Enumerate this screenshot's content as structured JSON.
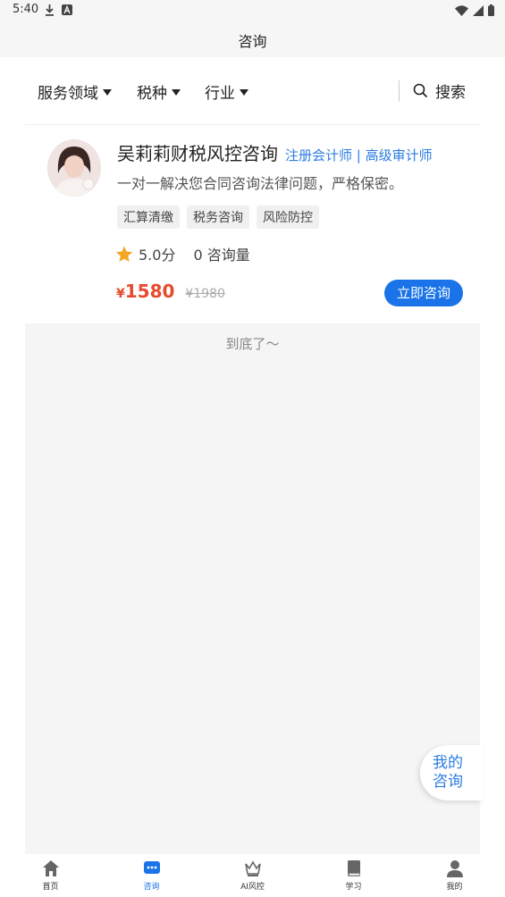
{
  "status_bar": {
    "time": "5:40"
  },
  "title_bar": {
    "title": "咨询"
  },
  "filters": {
    "items": [
      {
        "label": "服务领域"
      },
      {
        "label": "税种"
      },
      {
        "label": "行业"
      }
    ],
    "search_label": "搜索"
  },
  "advisor": {
    "name": "吴莉莉财税风控咨询",
    "title": "注册会计师 | 高级审计师",
    "description": "一对一解决您合同咨询法律问题，严格保密。",
    "tags": [
      "汇算清缴",
      "税务咨询",
      "风险防控"
    ],
    "rating": "5.0分",
    "consult_count": "0 咨询量",
    "currency": "¥",
    "price": "1580",
    "original_price": "¥1980",
    "consult_button": "立即咨询"
  },
  "list_end_text": "到底了～",
  "float_button": {
    "line1": "我的",
    "line2": "咨询"
  },
  "tab_bar": {
    "tabs": [
      {
        "label": "首页",
        "icon": "home-icon"
      },
      {
        "label": "咨询",
        "icon": "chat-icon",
        "active": true
      },
      {
        "label": "AI风控",
        "icon": "crown-icon"
      },
      {
        "label": "学习",
        "icon": "book-icon"
      },
      {
        "label": "我的",
        "icon": "user-icon"
      }
    ]
  },
  "colors": {
    "accent": "#1a73e8",
    "price": "#e64a2e",
    "title_blue": "#2a7de1",
    "star": "#f5a623"
  }
}
